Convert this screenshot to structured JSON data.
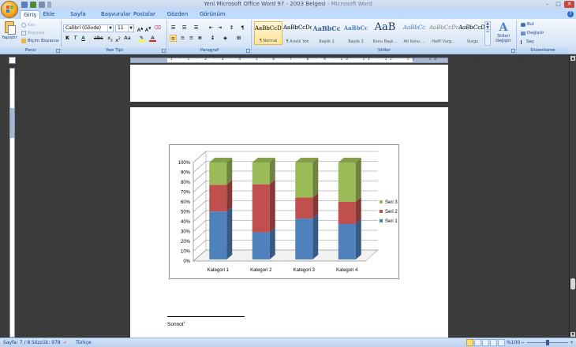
{
  "titlebar": {
    "doc_title": "Yeni Microsoft Office Word 97 - 2003 Belgesi",
    "app_name": " - Microsoft Word",
    "minimize": "–",
    "maximize": "□",
    "close": "✕"
  },
  "tabs": [
    "Giriş",
    "Ekle",
    "Sayfa Düzeni",
    "Başvurular",
    "Postalar",
    "Gözden Geçir",
    "Görünüm"
  ],
  "ribbon": {
    "clipboard": {
      "paste": "Yapıştır",
      "cut": "Kes",
      "copy": "Kopyala",
      "format_painter": "Biçim Boyacısı",
      "label": "Pano"
    },
    "font": {
      "font_name": "Calibri (Gövde)",
      "font_size": "11",
      "label": "Yazı Tipi"
    },
    "paragraph": {
      "label": "Paragraf"
    },
    "styles": {
      "items": [
        {
          "sample": "AaBbCcDc",
          "name": "¶ Normal"
        },
        {
          "sample": "AaBbCcDc",
          "name": "¶ Aralık Yok"
        },
        {
          "sample": "AaBbCc",
          "name": "Başlık 1"
        },
        {
          "sample": "AaBbCc",
          "name": "Başlık 2"
        },
        {
          "sample": "AaB",
          "name": "Konu Başlı..."
        },
        {
          "sample": "AaBbCc",
          "name": "Alt Konu ..."
        },
        {
          "sample": "AaBbCcDı",
          "name": "Hafif Vurg..."
        },
        {
          "sample": "AaBbCcDı",
          "name": "Vurgu"
        }
      ],
      "change_styles": "Stilleri Değiştir",
      "label": "Stiller"
    },
    "editing": {
      "find": "Bul",
      "replace": "Değiştir",
      "select": "Seç",
      "label": "Düzenleme"
    }
  },
  "ruler_numbers": "1 · 1 · 2 · 3 · 4 · 5 · 6 · 7 · 8 · 9 · 10 · 11 · 12 · 13 · 14 · 15 · 16 · 17 · 18",
  "chart_data": {
    "type": "bar",
    "stacked": "percent",
    "categories": [
      "Kategori 1",
      "Kategori 2",
      "Kategori 3",
      "Kategori 4"
    ],
    "series": [
      {
        "name": "Seri 1",
        "values": [
          4.3,
          2.5,
          3.5,
          4.5
        ],
        "color": "#4f81bd"
      },
      {
        "name": "Seri 2",
        "values": [
          2.4,
          4.4,
          1.8,
          2.8
        ],
        "color": "#c0504d"
      },
      {
        "name": "Seri 3",
        "values": [
          2,
          2,
          3,
          5
        ],
        "color": "#9bbb59"
      }
    ],
    "yticks": [
      "0%",
      "10%",
      "20%",
      "30%",
      "40%",
      "50%",
      "60%",
      "70%",
      "80%",
      "90%",
      "100%"
    ],
    "ylim": [
      0,
      100
    ],
    "legend": "right",
    "grid": true
  },
  "footnote": {
    "text": "Sonnot",
    "mark": "1"
  },
  "statusbar": {
    "page": "Sayfa: 7 / 8",
    "words": "Sözcük: 978",
    "language": "Türkçe",
    "zoom": "%100"
  }
}
